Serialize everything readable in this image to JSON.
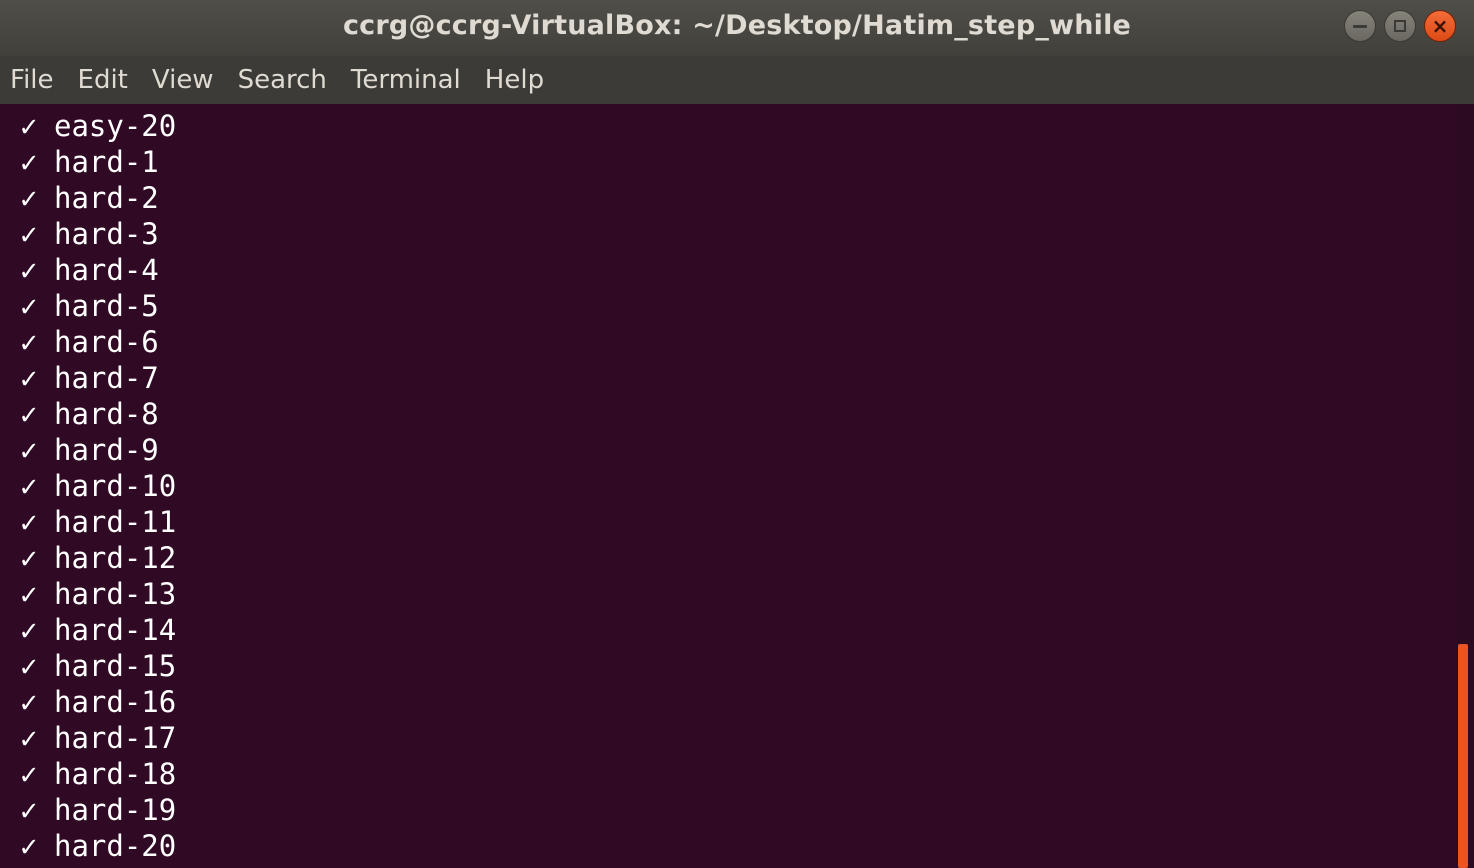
{
  "window": {
    "title": "ccrg@ccrg-VirtualBox: ~/Desktop/Hatim_step_while",
    "controls": {
      "minimize_icon": "minimize-icon",
      "maximize_icon": "maximize-icon",
      "close_icon": "close-icon",
      "close_glyph": "×"
    }
  },
  "menubar": {
    "items": [
      "File",
      "Edit",
      "View",
      "Search",
      "Terminal",
      "Help"
    ]
  },
  "terminal": {
    "check_glyph": "✓",
    "lines": [
      "easy-20",
      "hard-1",
      "hard-2",
      "hard-3",
      "hard-4",
      "hard-5",
      "hard-6",
      "hard-7",
      "hard-8",
      "hard-9",
      "hard-10",
      "hard-11",
      "hard-12",
      "hard-13",
      "hard-14",
      "hard-15",
      "hard-16",
      "hard-17",
      "hard-18",
      "hard-19",
      "hard-20"
    ]
  },
  "colors": {
    "terminal_bg": "#300a24",
    "accent": "#e95420",
    "text": "#ffffff"
  }
}
